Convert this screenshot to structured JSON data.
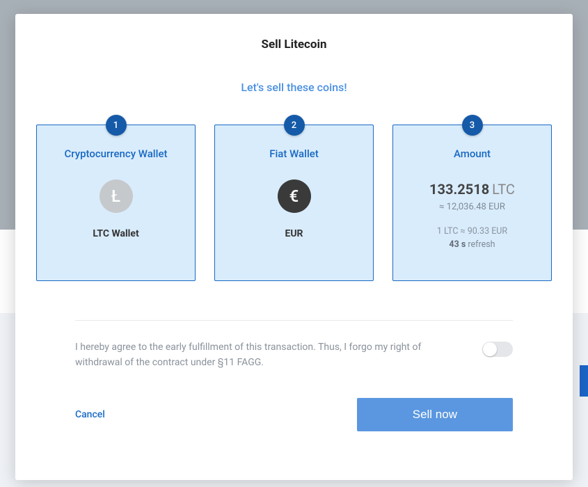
{
  "modal": {
    "title": "Sell Litecoin",
    "subtitle": "Let's sell these coins!"
  },
  "steps": {
    "crypto": {
      "num": "1",
      "title": "Cryptocurrency Wallet",
      "icon_glyph": "Ł",
      "icon_name": "litecoin-icon",
      "wallet_name": "LTC Wallet"
    },
    "fiat": {
      "num": "2",
      "title": "Fiat Wallet",
      "icon_glyph": "€",
      "icon_name": "euro-icon",
      "wallet_name": "EUR"
    },
    "amount": {
      "num": "3",
      "title": "Amount",
      "value": "133.2518",
      "currency": "LTC",
      "approx": "≈ 12,036.48 EUR",
      "rate": "1 LTC ≈ 90.33 EUR",
      "refresh_seconds": "43 s",
      "refresh_label": "refresh"
    }
  },
  "agreement": {
    "text": "I hereby agree to the early fulfillment of this transaction. Thus, I forgo my right of withdrawal of the contract under §11 FAGG.",
    "enabled": false
  },
  "actions": {
    "cancel": "Cancel",
    "sell": "Sell now"
  }
}
